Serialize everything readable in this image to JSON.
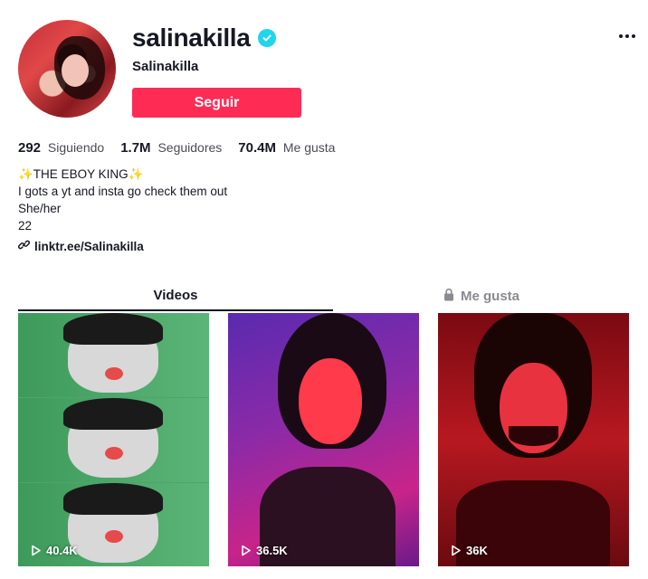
{
  "profile": {
    "username": "salinakilla",
    "nickname": "Salinakilla",
    "follow_label": "Seguir",
    "verified_icon": "verified-check-icon"
  },
  "stats": [
    {
      "value": "292",
      "label": "Siguiendo"
    },
    {
      "value": "1.7M",
      "label": "Seguidores"
    },
    {
      "value": "70.4M",
      "label": "Me gusta"
    }
  ],
  "bio": {
    "line1": "✨THE EBOY KING✨",
    "line2": "I gots a yt and insta go check them out",
    "line3": "She/her",
    "line4": "22"
  },
  "link": {
    "text": "linktr.ee/Salinakilla",
    "icon": "link-icon"
  },
  "tabs": [
    {
      "label": "Videos",
      "active": true
    },
    {
      "label": "Me gusta",
      "active": false,
      "icon": "lock-icon"
    }
  ],
  "videos": [
    {
      "views": "40.4K"
    },
    {
      "views": "36.5K"
    },
    {
      "views": "36K"
    }
  ],
  "colors": {
    "accent": "#fe2c55",
    "verified": "#20d5ec",
    "text": "#161823",
    "muted": "#8a8b91"
  }
}
